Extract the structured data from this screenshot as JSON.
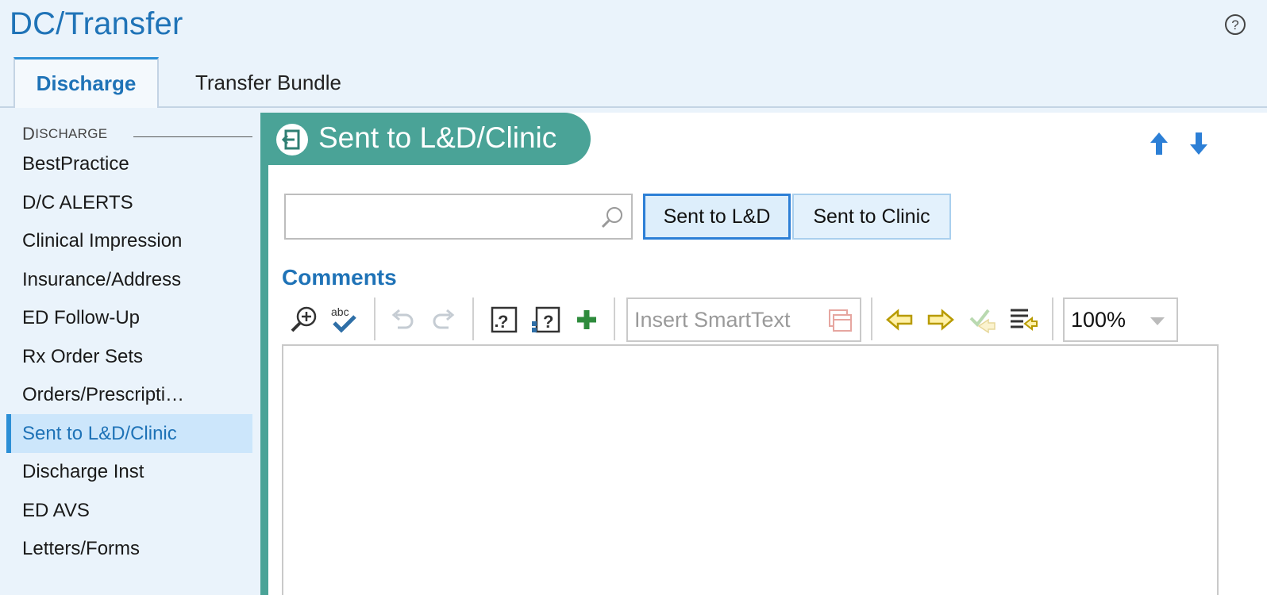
{
  "app": {
    "title": "DC/Transfer"
  },
  "tabs": [
    {
      "label": "Discharge",
      "active": true
    },
    {
      "label": "Transfer Bundle",
      "active": false
    }
  ],
  "sidebar": {
    "header": "DISCHARGE",
    "items": [
      {
        "label": "BestPractice"
      },
      {
        "label": "D/C ALERTS"
      },
      {
        "label": "Clinical Impression"
      },
      {
        "label": "Insurance/Address"
      },
      {
        "label": "ED Follow-Up"
      },
      {
        "label": "Rx Order Sets"
      },
      {
        "label": "Orders/Prescripti…"
      },
      {
        "label": "Sent to L&D/Clinic",
        "active": true
      },
      {
        "label": "Discharge Inst"
      },
      {
        "label": "ED AVS"
      },
      {
        "label": "Letters/Forms"
      }
    ]
  },
  "section": {
    "title": "Sent to L&D/Clinic",
    "icon": "exit-door-icon"
  },
  "search": {
    "value": "",
    "placeholder": ""
  },
  "options": [
    {
      "label": "Sent to L&D",
      "selected": true
    },
    {
      "label": "Sent to Clinic",
      "selected": false
    }
  ],
  "comments": {
    "label": "Comments",
    "smarttext_placeholder": "Insert SmartText",
    "zoom": "100%",
    "body": ""
  },
  "colors": {
    "accent": "#1f73b7",
    "section_teal": "#4aa397",
    "selection_blue": "#cce6fb",
    "background": "#eaf3fb"
  }
}
